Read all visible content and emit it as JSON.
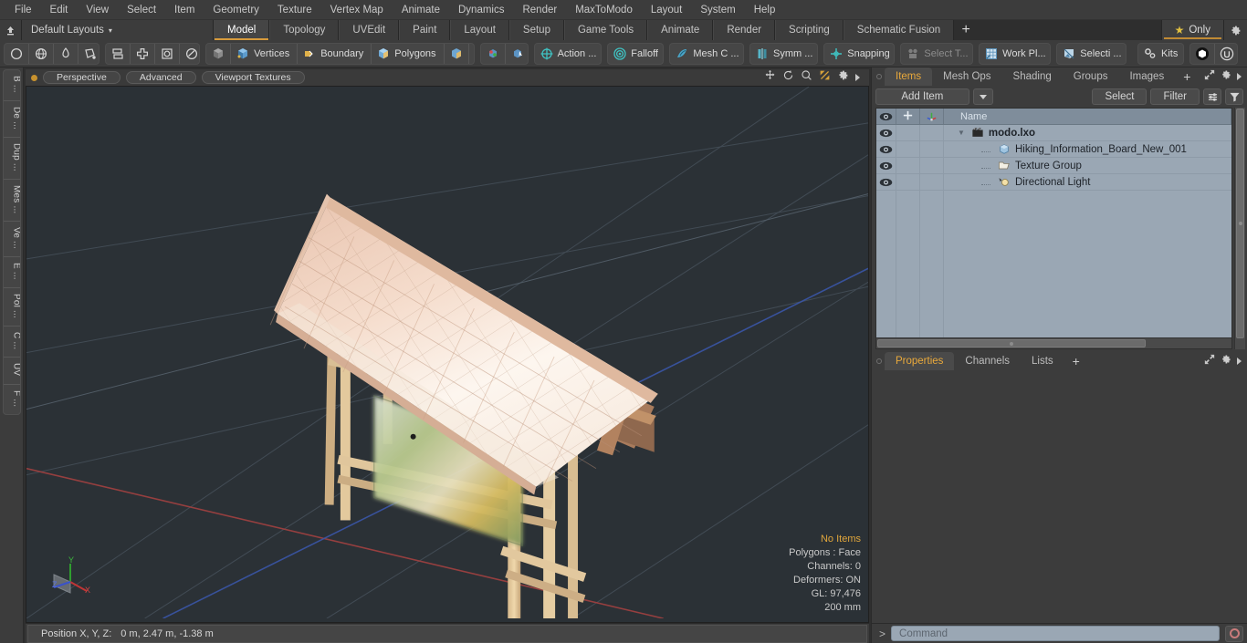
{
  "app": {
    "title": "MODO",
    "accent": "#d79b3c",
    "panel_bg": "#3c3c3c",
    "list_bg": "#9aa7b4",
    "viewport_bg": "#2b3136"
  },
  "menubar": {
    "items": [
      {
        "label": "File"
      },
      {
        "label": "Edit"
      },
      {
        "label": "View"
      },
      {
        "label": "Select"
      },
      {
        "label": "Item"
      },
      {
        "label": "Geometry"
      },
      {
        "label": "Texture"
      },
      {
        "label": "Vertex Map"
      },
      {
        "label": "Animate"
      },
      {
        "label": "Dynamics"
      },
      {
        "label": "Render"
      },
      {
        "label": "MaxToModo"
      },
      {
        "label": "Layout"
      },
      {
        "label": "System"
      },
      {
        "label": "Help"
      }
    ]
  },
  "layout_row": {
    "home_icon": "home-up-arrow-icon",
    "layout_picker": "Default Layouts",
    "layout_caret": "▾",
    "tabs": [
      {
        "label": "Model",
        "active": true
      },
      {
        "label": "Topology",
        "active": false
      },
      {
        "label": "UVEdit",
        "active": false
      },
      {
        "label": "Paint",
        "active": false
      },
      {
        "label": "Layout",
        "active": false
      },
      {
        "label": "Setup",
        "active": false
      },
      {
        "label": "Game Tools",
        "active": false
      },
      {
        "label": "Animate",
        "active": false
      },
      {
        "label": "Render",
        "active": false
      },
      {
        "label": "Scripting",
        "active": false
      },
      {
        "label": "Schematic Fusion",
        "active": false
      }
    ],
    "add_tab": "+",
    "only_button": {
      "label": "Only",
      "icon": "star-icon"
    },
    "gear_icon": "gear-icon"
  },
  "toolbar": {
    "groups": [
      {
        "name": "falloff-shapes",
        "buttons": [
          {
            "icon": "circle-outline-icon",
            "label": ""
          },
          {
            "icon": "globe-icon",
            "label": ""
          },
          {
            "icon": "teardrop-icon",
            "label": ""
          },
          {
            "icon": "lasso-icon",
            "label": ""
          }
        ]
      },
      {
        "name": "element-modes",
        "buttons": [
          {
            "icon": "stack-icon",
            "label": ""
          },
          {
            "icon": "cross-box-icon",
            "label": ""
          },
          {
            "icon": "square-circle-icon",
            "label": ""
          },
          {
            "icon": "circle-slash-icon",
            "label": ""
          }
        ]
      },
      {
        "name": "selection-modes",
        "buttons": [
          {
            "icon": "cube-gray-icon",
            "label": ""
          },
          {
            "icon": "cube-blue-icon",
            "label": "Vertices"
          },
          {
            "icon": "boundary-icon",
            "label": "Boundary"
          },
          {
            "icon": "polygons-icon",
            "label": "Polygons"
          },
          {
            "icon": "cube-tan-icon",
            "label": ""
          },
          {
            "icon": "chevron-down-icon",
            "label": ""
          }
        ]
      },
      {
        "name": "snap-helpers",
        "buttons": [
          {
            "icon": "element-move-icon",
            "label": ""
          },
          {
            "icon": "element-pick-icon",
            "label": ""
          }
        ]
      },
      {
        "name": "action-center",
        "buttons": [
          {
            "icon": "action-center-icon",
            "label": "Action  ..."
          }
        ]
      },
      {
        "name": "falloff",
        "buttons": [
          {
            "icon": "falloff-icon",
            "label": "Falloff"
          }
        ]
      },
      {
        "name": "mesh-constraint",
        "buttons": [
          {
            "icon": "mesh-constraint-icon",
            "label": "Mesh C ..."
          }
        ]
      },
      {
        "name": "symmetry",
        "buttons": [
          {
            "icon": "symmetry-icon",
            "label": "Symm ..."
          }
        ]
      },
      {
        "name": "snapping",
        "buttons": [
          {
            "icon": "snapping-icon",
            "label": "Snapping"
          }
        ]
      },
      {
        "name": "select-through",
        "buttons": [
          {
            "icon": "select-through-icon",
            "label": "Select T...",
            "dim": true
          }
        ]
      },
      {
        "name": "work-plane",
        "buttons": [
          {
            "icon": "work-plane-icon",
            "label": "Work Pl..."
          }
        ]
      },
      {
        "name": "selection-sets",
        "buttons": [
          {
            "icon": "selection-set-icon",
            "label": "Selecti ..."
          }
        ]
      },
      {
        "name": "kits",
        "buttons": [
          {
            "icon": "kits-gears-icon",
            "label": "Kits"
          }
        ]
      },
      {
        "name": "engines",
        "buttons": [
          {
            "icon": "unity-cube-icon",
            "label": ""
          },
          {
            "icon": "unreal-icon",
            "label": ""
          }
        ]
      }
    ]
  },
  "left_strip": {
    "tabs": [
      {
        "label": "B ..."
      },
      {
        "label": "De ..."
      },
      {
        "label": "Dup ..."
      },
      {
        "label": "Mes ..."
      },
      {
        "label": "Ve ..."
      },
      {
        "label": "E ..."
      },
      {
        "label": "Pol ..."
      },
      {
        "label": "C ..."
      },
      {
        "label": "UV"
      },
      {
        "label": "F ..."
      }
    ]
  },
  "viewport": {
    "header": {
      "chips": [
        "Perspective",
        "Advanced",
        "Viewport Textures"
      ],
      "icons": [
        "move-view-icon",
        "rotate-view-icon",
        "zoom-view-icon",
        "fit-view-icon",
        "viewport-gear-icon",
        "viewport-more-icon"
      ]
    },
    "gizmo": {
      "x_label": "X",
      "y_label": "Y",
      "z_label": "Z",
      "x_color": "#cc3333",
      "y_color": "#33aa33",
      "z_color": "#3355dd"
    },
    "stats": [
      {
        "text": "No Items",
        "highlight": true
      },
      {
        "text": "Polygons : Face",
        "highlight": false
      },
      {
        "text": "Channels: 0",
        "highlight": false
      },
      {
        "text": "Deformers: ON",
        "highlight": false
      },
      {
        "text": "GL: 97,476",
        "highlight": false
      },
      {
        "text": "200 mm",
        "highlight": false
      }
    ]
  },
  "position_bar": {
    "label": "Position X, Y, Z:",
    "value": "0 m, 2.47 m, -1.38 m"
  },
  "right_panel": {
    "tabs": [
      {
        "label": "Items",
        "active": true
      },
      {
        "label": "Mesh Ops",
        "active": false
      },
      {
        "label": "Shading",
        "active": false
      },
      {
        "label": "Groups",
        "active": false
      },
      {
        "label": "Images",
        "active": false
      }
    ],
    "add_tab": "+",
    "tab_icons": [
      "expand-panel-icon",
      "panel-gear-icon",
      "panel-more-icon"
    ],
    "toolrow": {
      "add_item": "Add Item",
      "add_item_caret": "▾",
      "select": "Select",
      "filter": "Filter",
      "list_icon": "list-options-icon",
      "funnel_icon": "funnel-icon"
    },
    "list": {
      "columns": [
        "",
        "",
        "",
        "Name"
      ],
      "col_icons": [
        "eye-icon",
        "move-lock-icon",
        "axis-icon"
      ],
      "rows": [
        {
          "name": "modo.lxo",
          "icon": "scene-icon",
          "indent": 0,
          "bold": true,
          "expander": "▼",
          "visible": true
        },
        {
          "name": "Hiking_Information_Board_New_001",
          "icon": "mesh-cube-icon",
          "indent": 1,
          "bold": false,
          "expander": "",
          "visible": true
        },
        {
          "name": "Texture Group",
          "icon": "folder-icon",
          "indent": 1,
          "bold": false,
          "expander": "",
          "visible": true
        },
        {
          "name": "Directional Light",
          "icon": "light-icon",
          "indent": 1,
          "bold": false,
          "expander": "",
          "visible": true
        }
      ]
    },
    "properties_tabs": [
      {
        "label": "Properties",
        "active": true
      },
      {
        "label": "Channels",
        "active": false
      },
      {
        "label": "Lists",
        "active": false
      }
    ],
    "properties_add_tab": "+"
  },
  "command_bar": {
    "prompt": ">",
    "placeholder": "Command",
    "record_icon": "record-icon"
  }
}
